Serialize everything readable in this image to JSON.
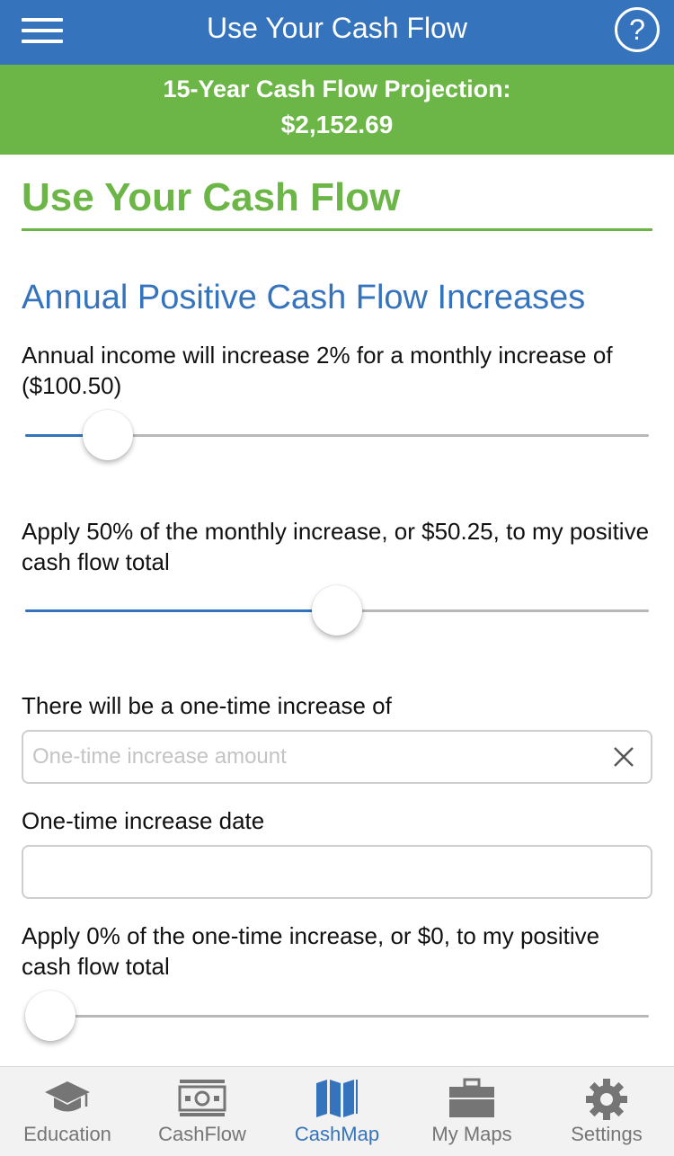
{
  "header": {
    "title": "Use Your Cash Flow",
    "help_symbol": "?"
  },
  "projection": {
    "label": "15-Year Cash Flow Projection:",
    "value": "$2,152.69"
  },
  "page": {
    "title": "Use Your Cash Flow",
    "section_title": "Annual Positive Cash Flow Increases"
  },
  "income_increase": {
    "label": "Annual income will increase 2% for a monthly increase of ($100.50)",
    "slider_level_percent": 10
  },
  "apply_monthly": {
    "label": "Apply 50% of the monthly increase, or $50.25, to my positive cash flow total",
    "slider_level_percent": 50
  },
  "one_time": {
    "label": "There will be a one-time increase of",
    "placeholder": "One-time increase amount",
    "value": ""
  },
  "one_time_date": {
    "label": "One-time increase date",
    "value": ""
  },
  "apply_one_time": {
    "label": "Apply 0% of the one-time increase, or $0, to my positive cash flow total",
    "slider_level_percent": 0
  },
  "tabs": [
    {
      "label": "Education",
      "icon": "graduation-cap-icon"
    },
    {
      "label": "CashFlow",
      "icon": "banknote-icon"
    },
    {
      "label": "CashMap",
      "icon": "map-icon",
      "active": true
    },
    {
      "label": "My Maps",
      "icon": "briefcase-icon"
    },
    {
      "label": "Settings",
      "icon": "gear-icon"
    }
  ],
  "colors": {
    "header_blue": "#3574bd",
    "accent_green": "#6bb646",
    "track_gray": "#b8b8b8",
    "tab_inactive": "#757575"
  }
}
